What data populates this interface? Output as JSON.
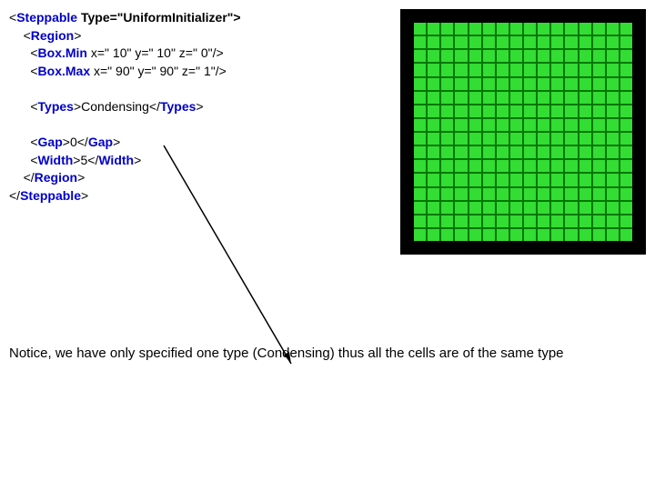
{
  "code": {
    "line1_open": "<",
    "line1_tag": "Steppable",
    "line1_attr": " Type=\"UniformInitializer\">",
    "line2_open": "<",
    "line2_tag": "Region",
    "line2_close": ">",
    "line3_open": "<",
    "line3_tag": "Box.Min",
    "line3_attr": " x=\" 10\" y=\" 10\" z=\" 0\"/>",
    "line4_open": "<",
    "line4_tag": "Box.Max",
    "line4_attr": " x=\" 90\" y=\" 90\" z=\" 1\"/>",
    "line5_open": "<",
    "line5_tag": "Types",
    "line5_close1": ">",
    "line5_text": "Condensing",
    "line5_open2": "</",
    "line5_tag2": "Types",
    "line5_close2": ">",
    "line6_open": "<",
    "line6_tag": "Gap",
    "line6_close1": ">",
    "line6_text": "0",
    "line6_open2": "</",
    "line6_tag2": "Gap",
    "line6_close2": ">",
    "line7_open": "<",
    "line7_tag": "Width",
    "line7_close1": ">",
    "line7_text": "5",
    "line7_open2": "</",
    "line7_tag2": "Width",
    "line7_close2": ">",
    "line8_open": "</",
    "line8_tag": "Region",
    "line8_close": ">",
    "line9_open": "</",
    "line9_tag": "Steppable",
    "line9_close": ">"
  },
  "notice": "Notice, we have only specified one type (Condensing) thus all the cells are of the same type",
  "grid": {
    "rows": 16,
    "cols": 16
  }
}
